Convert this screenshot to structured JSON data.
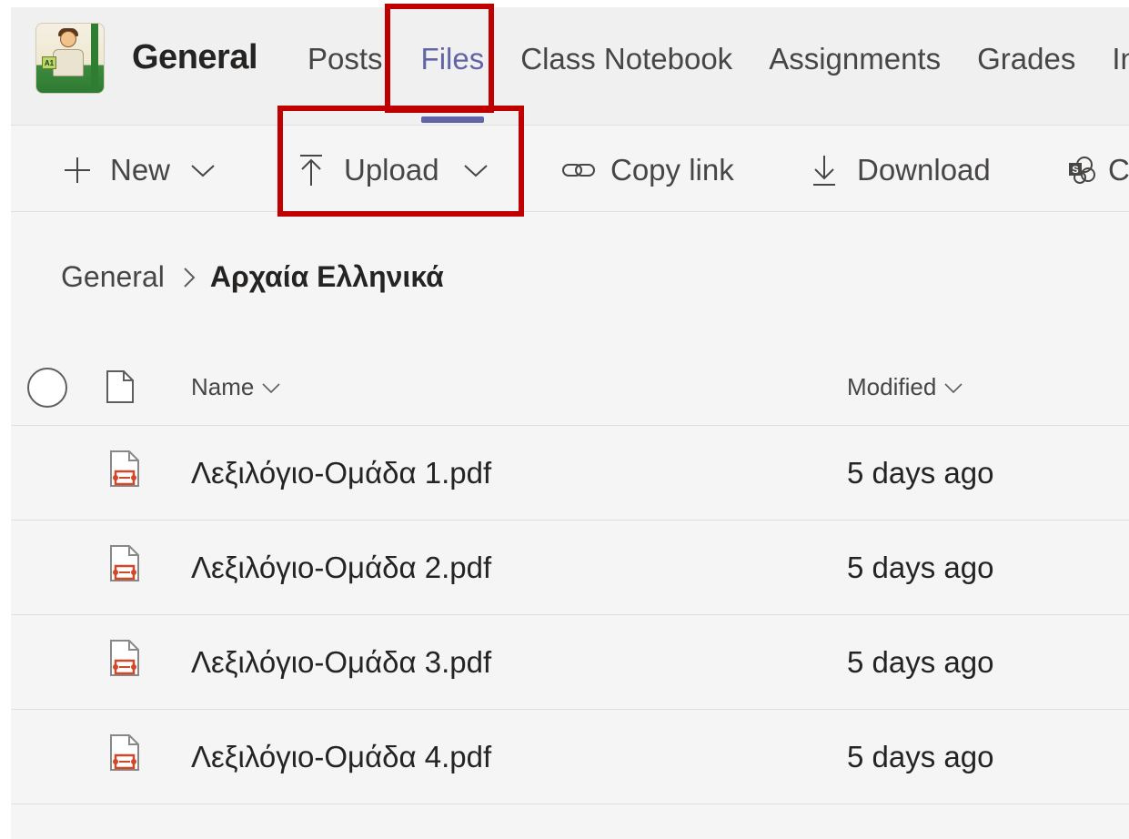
{
  "header": {
    "team_name": "General",
    "logo_text": "A1",
    "tabs": [
      {
        "label": "Posts"
      },
      {
        "label": "Files",
        "active": true
      },
      {
        "label": "Class Notebook"
      },
      {
        "label": "Assignments"
      },
      {
        "label": "Grades"
      },
      {
        "label": "Ins"
      }
    ]
  },
  "toolbar": {
    "new_label": "New",
    "upload_label": "Upload",
    "copy_link_label": "Copy link",
    "download_label": "Download",
    "overflow_label": "C"
  },
  "breadcrumb": {
    "root": "General",
    "current": "Αρχαία Ελληνικά"
  },
  "list": {
    "columns": {
      "name": "Name",
      "modified": "Modified"
    },
    "rows": [
      {
        "name": "Λεξιλόγιο-Ομάδα 1.pdf",
        "modified": "5 days ago"
      },
      {
        "name": "Λεξιλόγιο-Ομάδα 2.pdf",
        "modified": "5 days ago"
      },
      {
        "name": "Λεξιλόγιο-Ομάδα 3.pdf",
        "modified": "5 days ago"
      },
      {
        "name": "Λεξιλόγιο-Ομάδα 4.pdf",
        "modified": "5 days ago"
      }
    ]
  },
  "colors": {
    "accent": "#6264a7",
    "highlight": "#c00000",
    "pdf_red": "#d24726"
  }
}
